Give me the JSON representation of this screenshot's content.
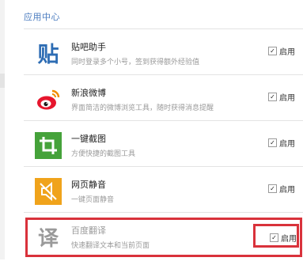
{
  "section_title": "应用中心",
  "extensions": [
    {
      "name": "贴吧助手",
      "desc": "同时登录多个小号，签到获得额外经验值",
      "toggle_label": "启用",
      "checked": true,
      "icon": "tieba-icon",
      "icon_glyph": "贴",
      "icon_color": "#2e6db4"
    },
    {
      "name": "新浪微博",
      "desc": "界面简洁的微博浏览工具，随时获得消息提醒",
      "toggle_label": "启用",
      "checked": true,
      "icon": "weibo-icon",
      "icon_color": "#e6162d"
    },
    {
      "name": "一键截图",
      "desc": "方便快捷的截图工具",
      "toggle_label": "启用",
      "checked": true,
      "icon": "crop-icon",
      "icon_color": "#45a23a"
    },
    {
      "name": "网页静音",
      "desc": "一键页面静音",
      "toggle_label": "启用",
      "checked": true,
      "icon": "mute-icon",
      "icon_color": "#f0a31b"
    },
    {
      "name": "百度翻译",
      "desc": "快速翻译文本和当前页面",
      "toggle_label": "启用",
      "checked": true,
      "icon": "translate-icon",
      "icon_glyph": "译",
      "icon_color": "#9a9a9a"
    }
  ],
  "highlight_color": "#d9323b",
  "link_color": "#4a7bbf"
}
